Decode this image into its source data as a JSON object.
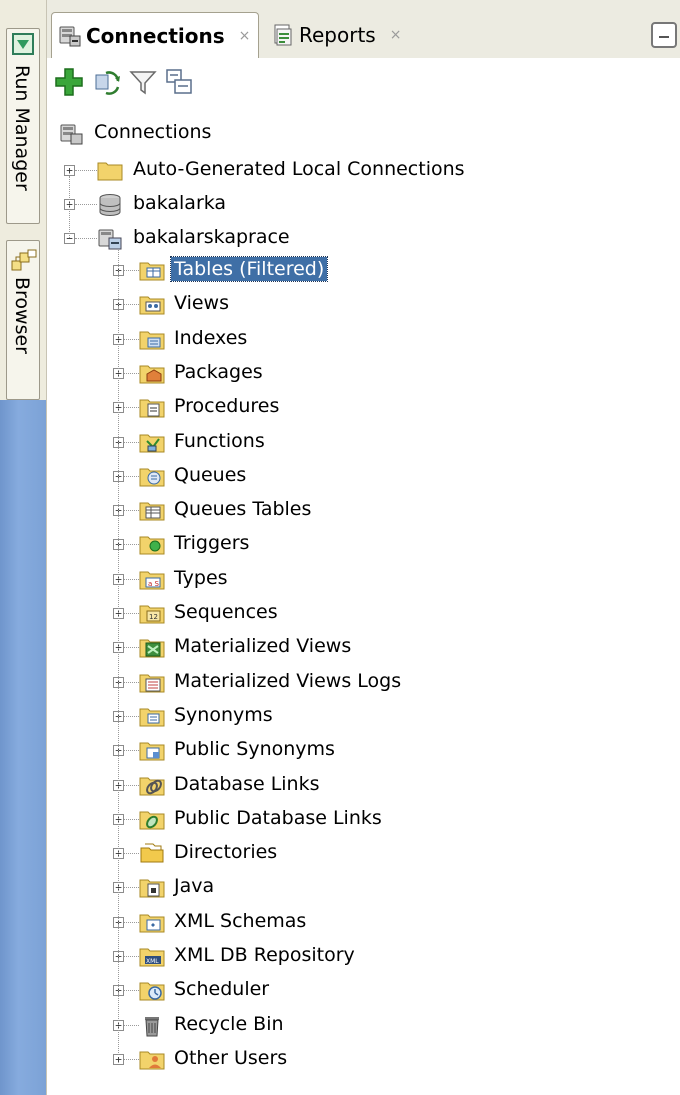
{
  "dock": {
    "run_manager": "Run Manager",
    "browser": "Browser"
  },
  "tabs": [
    {
      "label": "Connections",
      "close": "×",
      "icon": "connections-icon"
    },
    {
      "label": "Reports",
      "close": "×",
      "icon": "reports-icon"
    }
  ],
  "toolbar": [
    {
      "icon": "add-connection-icon",
      "color": "#2e9b2e"
    },
    {
      "icon": "refresh-icon"
    },
    {
      "icon": "filter-icon"
    },
    {
      "icon": "schema-browser-icon"
    }
  ],
  "tree": {
    "root": "Connections",
    "level1": [
      {
        "label": "Auto-Generated Local Connections",
        "icon": "folder-icon"
      },
      {
        "label": "bakalarka",
        "icon": "database-icon"
      },
      {
        "label": "bakalarskaprace",
        "icon": "connection-icon",
        "expanded": true
      }
    ],
    "children": [
      {
        "label": "Tables (Filtered)",
        "icon": "tables-icon",
        "selected": true
      },
      {
        "label": "Views",
        "icon": "views-icon"
      },
      {
        "label": "Indexes",
        "icon": "indexes-icon"
      },
      {
        "label": "Packages",
        "icon": "packages-icon"
      },
      {
        "label": "Procedures",
        "icon": "procedures-icon"
      },
      {
        "label": "Functions",
        "icon": "functions-icon"
      },
      {
        "label": "Queues",
        "icon": "queues-icon"
      },
      {
        "label": "Queues Tables",
        "icon": "queues-tables-icon"
      },
      {
        "label": "Triggers",
        "icon": "triggers-icon"
      },
      {
        "label": "Types",
        "icon": "types-icon"
      },
      {
        "label": "Sequences",
        "icon": "sequences-icon"
      },
      {
        "label": "Materialized Views",
        "icon": "materialized-views-icon"
      },
      {
        "label": "Materialized Views Logs",
        "icon": "materialized-views-logs-icon"
      },
      {
        "label": "Synonyms",
        "icon": "synonyms-icon"
      },
      {
        "label": "Public Synonyms",
        "icon": "public-synonyms-icon"
      },
      {
        "label": "Database Links",
        "icon": "database-links-icon"
      },
      {
        "label": "Public Database Links",
        "icon": "public-database-links-icon"
      },
      {
        "label": "Directories",
        "icon": "directories-icon"
      },
      {
        "label": "Java",
        "icon": "java-icon"
      },
      {
        "label": "XML Schemas",
        "icon": "xml-schemas-icon"
      },
      {
        "label": "XML DB Repository",
        "icon": "xml-db-repository-icon"
      },
      {
        "label": "Scheduler",
        "icon": "scheduler-icon"
      },
      {
        "label": "Recycle Bin",
        "icon": "recycle-bin-icon"
      },
      {
        "label": "Other Users",
        "icon": "other-users-icon"
      }
    ]
  },
  "colors": {
    "selection": "#3f6fa6",
    "dock_blue": "#7ca2d6",
    "folder": "#f2d36b"
  }
}
